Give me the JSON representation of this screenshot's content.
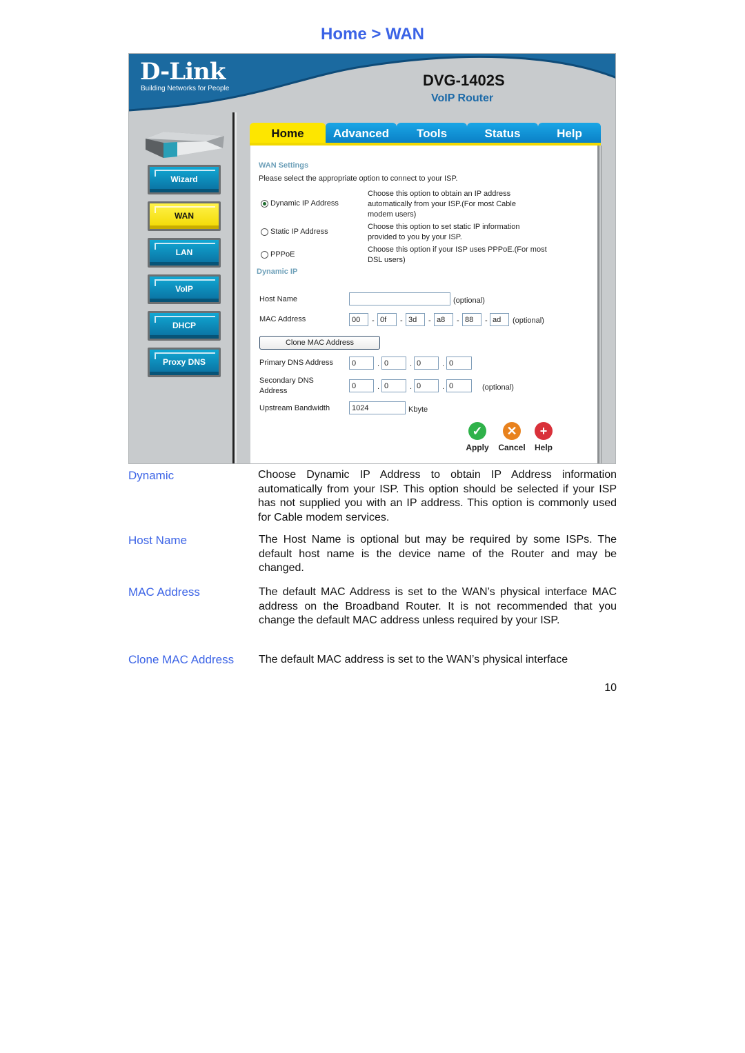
{
  "page": {
    "title": "Home > WAN",
    "page_number": "10"
  },
  "router_ui": {
    "brand": "D-Link",
    "tagline": "Building Networks for People",
    "model": "DVG-1402S",
    "product": "VoIP Router",
    "tabs": [
      {
        "label": "Home",
        "active": true
      },
      {
        "label": "Advanced",
        "active": false
      },
      {
        "label": "Tools",
        "active": false
      },
      {
        "label": "Status",
        "active": false
      },
      {
        "label": "Help",
        "active": false
      }
    ],
    "nav": [
      {
        "label": "Wizard",
        "active": false
      },
      {
        "label": "WAN",
        "active": true
      },
      {
        "label": "LAN",
        "active": false
      },
      {
        "label": "VoIP",
        "active": false
      },
      {
        "label": "DHCP",
        "active": false
      },
      {
        "label": "Proxy DNS",
        "active": false
      }
    ],
    "wan_settings": {
      "heading": "WAN Settings",
      "intro": "Please select the appropriate option to connect to your ISP.",
      "options": [
        {
          "label": "Dynamic IP Address",
          "selected": true,
          "description": "Choose this option to obtain an IP address automatically from your ISP.(For most Cable modem users)"
        },
        {
          "label": "Static IP Address",
          "selected": false,
          "description": "Choose this option to set static IP information provided to you by your ISP."
        },
        {
          "label": "PPPoE",
          "selected": false,
          "description": "Choose this option if your ISP uses PPPoE.(For most DSL users)"
        }
      ]
    },
    "dynamic_ip": {
      "heading": "Dynamic IP",
      "host_name_label": "Host Name",
      "host_name_value": "",
      "optional": "(optional)",
      "mac_label": "MAC Address",
      "mac": [
        "00",
        "0f",
        "3d",
        "a8",
        "88",
        "ad"
      ],
      "clone_button": "Clone MAC Address",
      "primary_dns_label": "Primary DNS Address",
      "primary_dns": [
        "0",
        "0",
        "0",
        "0"
      ],
      "secondary_dns_label_1": "Secondary DNS",
      "secondary_dns_label_2": "Address",
      "secondary_dns": [
        "0",
        "0",
        "0",
        "0"
      ],
      "bandwidth_label": "Upstream Bandwidth",
      "bandwidth_value": "1024",
      "bandwidth_unit": "Kbyte"
    },
    "actions": [
      {
        "label": "Apply",
        "icon": "check-icon",
        "color": "#2fb24a"
      },
      {
        "label": "Cancel",
        "icon": "x-icon",
        "color": "#e8821e"
      },
      {
        "label": "Help",
        "icon": "plus-icon",
        "color": "#d9313a"
      }
    ]
  },
  "descriptions": [
    {
      "term": "Dynamic",
      "text": "Choose Dynamic IP Address to obtain IP Address information automatically from your ISP. This option should be selected if your ISP has not supplied you with an IP address. This option is commonly used for Cable modem services."
    },
    {
      "term": "Host Name",
      "text": "The Host Name is optional but may be required by some ISPs. The default host name is the device name of the Router and may be changed."
    },
    {
      "term": "MAC Address",
      "text": "The default MAC Address is set to the WAN’s physical interface MAC address on the Broadband Router. It is not recommended that you change the default MAC address unless required by your ISP."
    },
    {
      "term": "Clone MAC Address",
      "text": "The default MAC address is set to the WAN’s physical interface"
    }
  ],
  "colors": {
    "accent_blue": "#3b63e6",
    "tab_blue": "#0a7fc5",
    "active_yellow": "#fde600",
    "section_heading": "#6ea0b9"
  }
}
